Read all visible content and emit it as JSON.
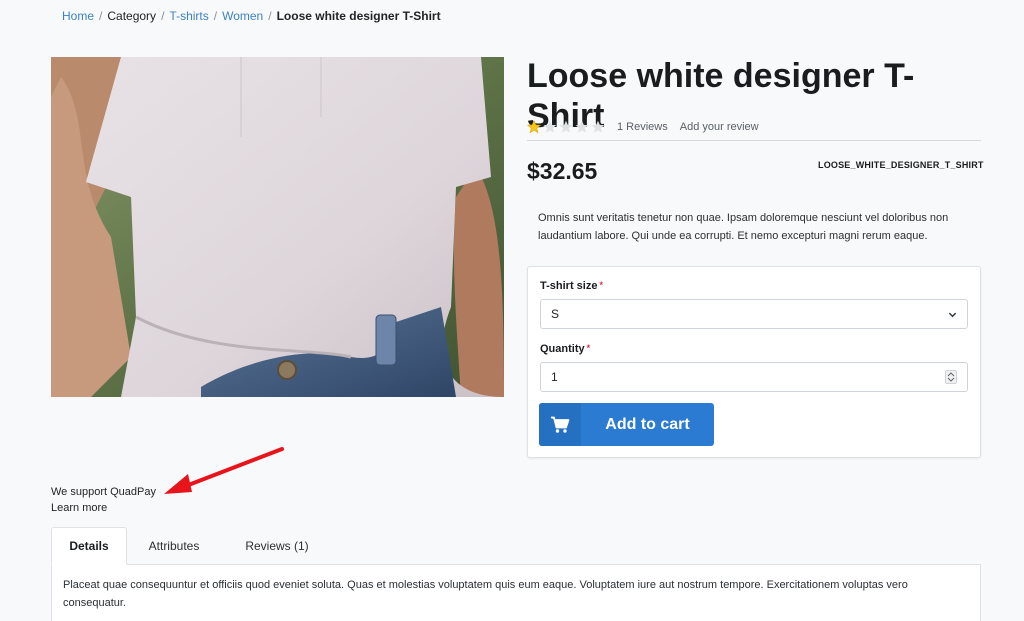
{
  "breadcrumb": {
    "home": "Home",
    "category": "Category",
    "tshirts": "T-shirts",
    "women": "Women",
    "current": "Loose white designer T-Shirt"
  },
  "product": {
    "title": "Loose white designer T-Shirt",
    "rating": 1,
    "max_rating": 5,
    "reviews_count_label": "1 Reviews",
    "add_review_label": "Add your review",
    "price": "$32.65",
    "sku": "LOOSE_WHITE_DESIGNER_T_SHIRT",
    "description": "Omnis sunt veritatis tenetur non quae. Ipsam doloremque nesciunt vel doloribus non laudantium labore. Qui unde ea corrupti. Et nemo excepturi magni rerum eaque."
  },
  "form": {
    "size_label": "T-shirt size",
    "size_value": "S",
    "quantity_label": "Quantity",
    "quantity_value": "1",
    "required_mark": "*",
    "add_to_cart_label": "Add to cart"
  },
  "quadpay": {
    "text": "We support QuadPay",
    "learn_more": "Learn more"
  },
  "tabs": {
    "items": [
      "Details",
      "Attributes",
      "Reviews (1)"
    ],
    "active": "Details",
    "details_text": "Placeat quae consequuntur et officiis quod eveniet soluta. Quas et molestias voluptatem quis eum eaque. Voluptatem iure aut nostrum tempore. Exercitationem voluptas vero consequatur."
  },
  "colors": {
    "link": "#3b82c4",
    "button": "#2a7bd1",
    "star": "#f5c518",
    "arrow": "#e8141b",
    "required": "#dc3545"
  },
  "icons": {
    "cart": "shopping-cart-icon",
    "chevron": "chevron-down-icon",
    "star": "star-icon",
    "arrow": "annotation-arrow"
  }
}
